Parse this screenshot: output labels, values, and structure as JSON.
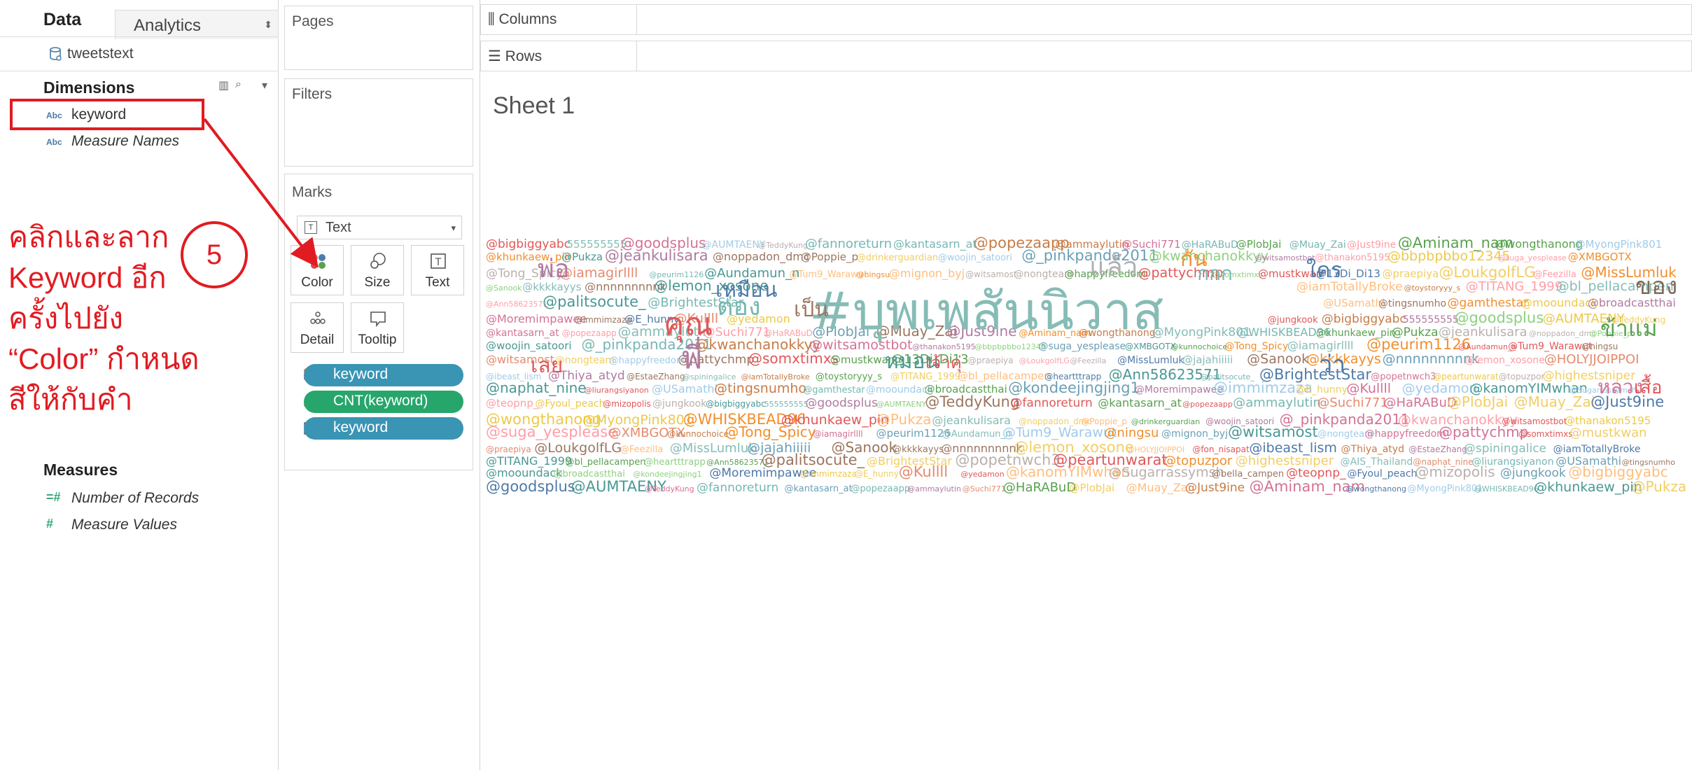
{
  "data_pane": {
    "tab_data": "Data",
    "tab_analytics": "Analytics",
    "datasource": "tweetstext",
    "dimensions_title": "Dimensions",
    "dimensions": [
      "keyword",
      "Measure Names"
    ],
    "measures_title": "Measures",
    "measures": [
      "Number of Records",
      "Measure Values"
    ]
  },
  "annotation": {
    "step": "5",
    "lines": [
      "คลิกและลาก",
      "Keyword อีก",
      "ครั้งไปยัง",
      "“Color” กำหนด",
      "สีให้กับคำ"
    ],
    "color": "#e11b22"
  },
  "shelves": {
    "pages": "Pages",
    "filters": "Filters",
    "marks": "Marks",
    "mark_type": "Text",
    "mark_buttons": [
      "Color",
      "Size",
      "Text",
      "Detail",
      "Tooltip"
    ],
    "pills": [
      {
        "label": "keyword",
        "kind": "color",
        "color": "#3a94b4"
      },
      {
        "label": "CNT(keyword)",
        "kind": "size",
        "color": "#27a66c"
      },
      {
        "label": "keyword",
        "kind": "text",
        "color": "#3a94b4"
      }
    ]
  },
  "worksheet": {
    "columns": "Columns",
    "rows": "Rows",
    "sheet_title": "Sheet 1",
    "main_word": "#บุพเพสันนิวาส",
    "big_words": [
      "คุณ",
      "ต่อง",
      "เป็น",
      "พี่",
      "หมอน",
      "เจ้าคุ่",
      "แล้ว",
      "ของ",
      "ข้าแม่",
      "ว่า",
      "กัน",
      "เหมือน",
      "เลย",
      "หลวง",
      "เสื้อ",
      "พ่อ",
      "กกก",
      "ใคร"
    ],
    "words": [
      "@bigbiggyabc",
      "555555555",
      "@goodsplus",
      "@AUMTAENY",
      "@TeddyKung",
      "@fannoreturn",
      "@kantasarn_at",
      "@popezaapp",
      "@ammaylutin",
      "@Suchi771",
      "@HaRABuD",
      "@PlobJai",
      "@Muay_Zai",
      "@Just9ine",
      "@Aminam_nam",
      "@wongthanong",
      "@MyongPink801",
      "@WHISKBEAD96",
      "@khunkaew_pin",
      "@Pukza",
      "@jeankulisara",
      "@noppadon_dmc",
      "@Poppie_p",
      "@drinkerguardian",
      "@woojin_satoori",
      "@_pinkpanda2011",
      "@kwanchanokkyy",
      "@witsamostbot",
      "@thanakon5195",
      "@bbpbpbbo12345",
      "@suga_yesplease",
      "@XMBGOTX",
      "@kunnochoice",
      "@Tong_Spicy",
      "@iamagirllll",
      "@peurim1126",
      "@Aundamun_n",
      "@Tum9_Warawut",
      "@ningsu",
      "@mignon_byj",
      "@witsamost",
      "@nongteam",
      "@happyfreedom",
      "@pattychmp",
      "@somxtimxs",
      "@mustkwan",
      "@13Di_Di13",
      "@praepiya",
      "@LoukgolfLG",
      "@Feezilla",
      "@MissLumluk",
      "@jajahiiiii",
      "@Sanook",
      "@kkkkayys",
      "@nnnnnnnnnk",
      "@lemon_xosone",
      "@HOLYJJOIPPOI",
      "@fon_nisapat",
      "@ibeast_lism",
      "@Thiya_atyd",
      "@EstaeZhang",
      "@spiningalice",
      "@iamTotallyBroke",
      "@toystoryyy_s",
      "@TITANG_1999",
      "@bl_pellacampen",
      "@heartttrapp",
      "@Ann58623571",
      "@palitsocute_",
      "@BrightestStar",
      "@popetnwch3",
      "@peartunwarat",
      "@topuzpor",
      "@highestsniper",
      "@AIS_Thailand",
      "@naphat_nine",
      "@liurangsiyanon",
      "@USamathi",
      "@tingsnumho",
      "@gamthestar",
      "@mooundack",
      "@broadcastthai",
      "@kondeejingjing1",
      "@Moremimpawee",
      "@immimzaza",
      "@E_hunny",
      "@Kullll",
      "@yedamon",
      "@kanomYIMwhan",
      "@Sugarrassymsh",
      "@bella_campen",
      "@teopnp_",
      "@Fyoul_peach",
      "@mizopolis",
      "@jungkook"
    ]
  }
}
